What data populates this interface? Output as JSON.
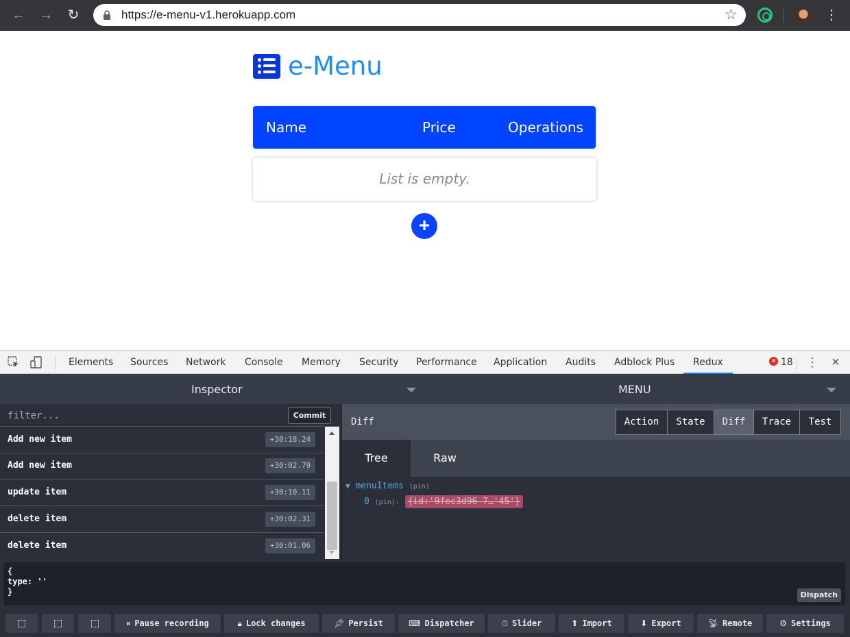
{
  "browser": {
    "url": "https://e-menu-v1.herokuapp.com",
    "icons": [
      "back-arrow-icon",
      "forward-arrow-icon",
      "reload-icon",
      "lock-icon",
      "bookmark-star-icon",
      "extension-icon",
      "profile-avatar",
      "more-vertical-icon"
    ]
  },
  "app": {
    "logo_text": "e-Menu",
    "table": {
      "columns": [
        "Name",
        "Price",
        "Operations"
      ]
    },
    "empty_message": "List is empty.",
    "add_button": "+",
    "colors": {
      "primary": "#0044ff",
      "logo_text": "#1e8ef0"
    }
  },
  "devtools": {
    "tabs": [
      "Elements",
      "Sources",
      "Network",
      "Console",
      "Memory",
      "Security",
      "Performance",
      "Application",
      "Audits",
      "Adblock Plus",
      "Redux"
    ],
    "selected_tab": "Redux",
    "error_count": "18"
  },
  "redux": {
    "left_title": "Inspector",
    "right_title": "MENU",
    "filter_placeholder": "filter...",
    "commit_label": "Commit",
    "actions": [
      {
        "name": "Add new item",
        "time": "+30:18.24"
      },
      {
        "name": "Add new item",
        "time": "+30:02.79"
      },
      {
        "name": "update item",
        "time": "+30:10.11"
      },
      {
        "name": "delete item",
        "time": "+30:02.31"
      },
      {
        "name": "delete item",
        "time": "+30:01.06"
      }
    ],
    "monitor_label": "Diff",
    "modes": [
      "Action",
      "State",
      "Diff",
      "Trace",
      "Test"
    ],
    "selected_mode": "Diff",
    "view_tabs": [
      "Tree",
      "Raw"
    ],
    "selected_view": "Tree",
    "tree": {
      "root_key": "menuItems",
      "root_pin": "(pin)",
      "child_key": "0",
      "child_pin": "(pin):",
      "child_value": "{id:'9fec3d96-7…'45'}"
    },
    "dispatcher": {
      "code_line1": "{",
      "code_line2": "type: ''",
      "code_line3": "}",
      "dispatch_label": "Dispatch"
    },
    "toolbar": {
      "pause": "Pause recording",
      "lock": "Lock changes",
      "persist": "Persist",
      "dispatcher": "Dispatcher",
      "slider": "Slider",
      "import": "Import",
      "export": "Export",
      "remote": "Remote",
      "settings": "Settings"
    }
  }
}
